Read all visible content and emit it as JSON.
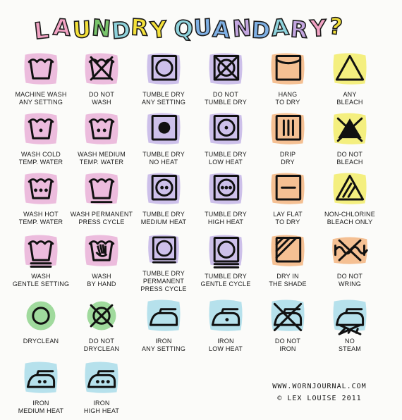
{
  "title": {
    "text": "LAUNDRY QUANDARY?",
    "letters": [
      "L",
      "A",
      "U",
      "N",
      "D",
      "R",
      "Y",
      "Q",
      "U",
      "A",
      "N",
      "D",
      "A",
      "R",
      "Y",
      "?"
    ],
    "colors": {
      "pink": "#f2a3c4",
      "yellow": "#f4e13a",
      "green": "#79c46b",
      "teal": "#8fd3dc",
      "blue": "#7fb0e4",
      "lavender": "#c3a6df",
      "outline": "#1a1a1a"
    }
  },
  "palette": {
    "pink": "#e9b0d8",
    "lavender": "#c4b5e8",
    "peach": "#f3b581",
    "yellow": "#f2ec6a",
    "green": "#8fd38d",
    "teal": "#a9dcea",
    "ink": "#111111"
  },
  "symbols": [
    {
      "label": "MACHINE WASH\nANY SETTING",
      "icon": "washtub-icon",
      "color": "pink"
    },
    {
      "label": "DO NOT\nWASH",
      "icon": "washtub-crossed-icon",
      "color": "pink"
    },
    {
      "label": "TUMBLE DRY\nANY SETTING",
      "icon": "tumble-dry-icon",
      "color": "lavender"
    },
    {
      "label": "DO NOT\nTUMBLE DRY",
      "icon": "tumble-dry-crossed-icon",
      "color": "lavender"
    },
    {
      "label": "HANG\nTO DRY",
      "icon": "hang-dry-icon",
      "color": "peach"
    },
    {
      "label": "ANY\nBLEACH",
      "icon": "bleach-triangle-icon",
      "color": "yellow"
    },
    {
      "label": "WASH COLD\nTEMP. WATER",
      "icon": "wash-one-dot-icon",
      "color": "pink"
    },
    {
      "label": "WASH MEDIUM\nTEMP. WATER",
      "icon": "wash-two-dots-icon",
      "color": "pink"
    },
    {
      "label": "TUMBLE DRY\nNO HEAT",
      "icon": "tumble-dry-no-heat-icon",
      "color": "lavender"
    },
    {
      "label": "TUMBLE DRY\nLOW HEAT",
      "icon": "tumble-dry-one-dot-icon",
      "color": "lavender"
    },
    {
      "label": "DRIP\nDRY",
      "icon": "drip-dry-icon",
      "color": "peach"
    },
    {
      "label": "DO NOT\nBLEACH",
      "icon": "no-bleach-icon",
      "color": "yellow"
    },
    {
      "label": "WASH HOT\nTEMP. WATER",
      "icon": "wash-three-dots-icon",
      "color": "pink"
    },
    {
      "label": "WASH PERMANENT\nPRESS CYCLE",
      "icon": "wash-permanent-press-icon",
      "color": "pink"
    },
    {
      "label": "TUMBLE DRY\nMEDIUM HEAT",
      "icon": "tumble-dry-two-dots-icon",
      "color": "lavender"
    },
    {
      "label": "TUMBLE DRY\nHIGH HEAT",
      "icon": "tumble-dry-three-dots-icon",
      "color": "lavender"
    },
    {
      "label": "LAY FLAT\nTO DRY",
      "icon": "lay-flat-icon",
      "color": "peach"
    },
    {
      "label": "NON-CHLORINE\nBLEACH ONLY",
      "icon": "non-chlorine-bleach-icon",
      "color": "yellow"
    },
    {
      "label": "WASH\nGENTLE SETTING",
      "icon": "wash-gentle-icon",
      "color": "pink"
    },
    {
      "label": "WASH\nBY HAND",
      "icon": "hand-wash-icon",
      "color": "pink"
    },
    {
      "label": "TUMBLE DRY\nPERMANENT\nPRESS CYCLE",
      "icon": "tumble-dry-permanent-press-icon",
      "color": "lavender"
    },
    {
      "label": "TUMBLE DRY\nGENTLE CYCLE",
      "icon": "tumble-dry-gentle-icon",
      "color": "lavender"
    },
    {
      "label": "DRY IN\nTHE SHADE",
      "icon": "dry-in-shade-icon",
      "color": "peach"
    },
    {
      "label": "DO NOT\nWRING",
      "icon": "do-not-wring-icon",
      "color": "peach"
    },
    {
      "label": "DRYCLEAN",
      "icon": "dryclean-icon",
      "color": "green"
    },
    {
      "label": "DO NOT\nDRYCLEAN",
      "icon": "do-not-dryclean-icon",
      "color": "green"
    },
    {
      "label": "IRON\nANY SETTING",
      "icon": "iron-icon",
      "color": "teal"
    },
    {
      "label": "IRON\nLOW HEAT",
      "icon": "iron-one-dot-icon",
      "color": "teal"
    },
    {
      "label": "DO NOT\nIRON",
      "icon": "do-not-iron-icon",
      "color": "teal"
    },
    {
      "label": "NO\nSTEAM",
      "icon": "no-steam-icon",
      "color": "teal"
    },
    {
      "label": "IRON\nMEDIUM HEAT",
      "icon": "iron-two-dots-icon",
      "color": "teal"
    },
    {
      "label": "IRON\nHIGH HEAT",
      "icon": "iron-three-dots-icon",
      "color": "teal"
    }
  ],
  "credit": {
    "url": "WWW.WORNJOURNAL.COM",
    "copyright": "© LEX LOUISE 2011"
  }
}
